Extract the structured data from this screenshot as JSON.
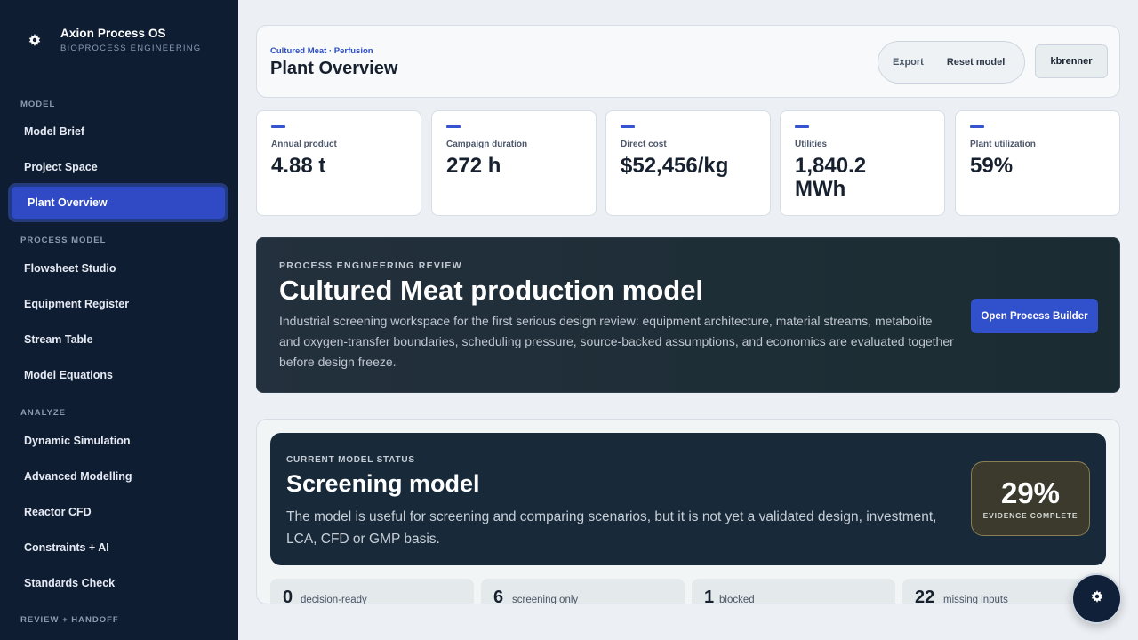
{
  "brand": {
    "title": "Axion Process OS",
    "subtitle": "BIOPROCESS ENGINEERING"
  },
  "sidebar": {
    "sections": [
      {
        "label": "MODEL",
        "items": [
          "Model Brief",
          "Project Space",
          "Plant Overview"
        ]
      },
      {
        "label": "PROCESS MODEL",
        "items": [
          "Flowsheet Studio",
          "Equipment Register",
          "Stream Table",
          "Model Equations"
        ]
      },
      {
        "label": "ANALYZE",
        "items": [
          "Dynamic Simulation",
          "Advanced Modelling",
          "Reactor CFD",
          "Constraints + AI",
          "Standards Check"
        ]
      },
      {
        "label": "REVIEW + HANDOFF",
        "items": []
      }
    ],
    "active": "Plant Overview"
  },
  "header": {
    "breadcrumb": "Cultured Meat · Perfusion",
    "title": "Plant Overview",
    "export_label": "Export",
    "reset_label": "Reset model",
    "user": "kbrenner"
  },
  "kpis": [
    {
      "label": "Annual product",
      "value": "4.88 t"
    },
    {
      "label": "Campaign duration",
      "value": "272 h"
    },
    {
      "label": "Direct cost",
      "value": "$52,456/kg"
    },
    {
      "label": "Utilities",
      "value": "1,840.2 MWh"
    },
    {
      "label": "Plant utilization",
      "value": "59%"
    }
  ],
  "review": {
    "kicker": "PROCESS ENGINEERING REVIEW",
    "title": "Cultured Meat production model",
    "description": "Industrial screening workspace for the first serious design review: equipment architecture, material streams, metabolite and oxygen-transfer boundaries, scheduling pressure, source-backed assumptions, and economics are evaluated together before design freeze.",
    "button": "Open Process Builder"
  },
  "status": {
    "kicker": "CURRENT MODEL STATUS",
    "title": "Screening model",
    "description": "The model is useful for screening and comparing scenarios, but it is not yet a validated design, investment, LCA, CFD or GMP basis.",
    "evidence_pct": "29%",
    "evidence_label": "EVIDENCE COMPLETE",
    "counts": [
      {
        "num": "0",
        "label": "decision-ready"
      },
      {
        "num": "6",
        "label": "screening only"
      },
      {
        "num": "1",
        "label": "blocked"
      },
      {
        "num": "22",
        "label": "missing inputs"
      }
    ]
  },
  "icons": {
    "brand": "gear-icon",
    "fab": "gear-icon"
  }
}
